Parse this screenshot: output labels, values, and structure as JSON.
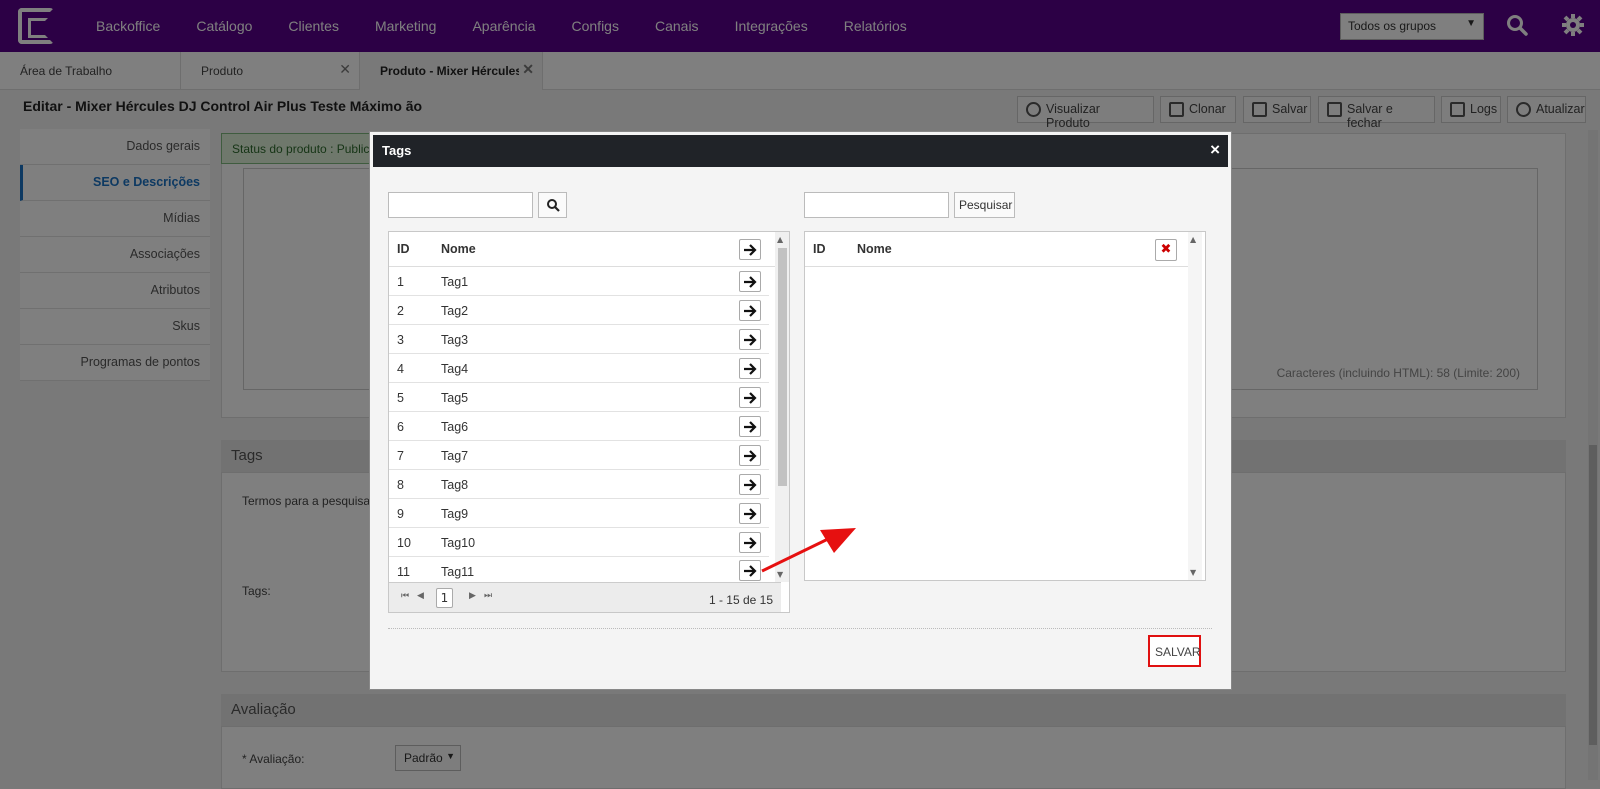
{
  "nav": {
    "items": [
      "Backoffice",
      "Catálogo",
      "Clientes",
      "Marketing",
      "Aparência",
      "Configs",
      "Canais",
      "Integrações",
      "Relatórios"
    ],
    "group_select": "Todos os grupos"
  },
  "tabs": [
    {
      "label": "Área de Trabalho"
    },
    {
      "label": "Produto"
    },
    {
      "label": "Produto - Mixer Hércules"
    }
  ],
  "page": {
    "title": "Editar - Mixer Hércules DJ Control Air Plus Teste Máximo ão",
    "toolbar": {
      "visualizar": "Visualizar Produto",
      "clonar": "Clonar",
      "salvar": "Salvar",
      "salvar_fechar": "Salvar e fechar",
      "logs": "Logs",
      "atualizar": "Atualizar"
    },
    "status": "Status do produto : Publicado",
    "char_count": "Caracteres (incluindo HTML): 58 (Limite: 200)",
    "tags_section": "Tags",
    "tags_terms_label": "Termos para a pesquisa",
    "tags_label": "Tags:",
    "avaliacao_section": "Avaliação",
    "avaliacao_label": "* Avaliação:",
    "avaliacao_value": "Padrão"
  },
  "leftmenu": [
    "Dados gerais",
    "SEO e Descrições",
    "Mídias",
    "Associações",
    "Atributos",
    "Skus",
    "Programas de pontos"
  ],
  "modal": {
    "title": "Tags",
    "close": "×",
    "right_search_button": "Pesquisar",
    "left_grid": {
      "col_id": "ID",
      "col_nome": "Nome",
      "rows": [
        {
          "id": "1",
          "nome": "Tag1"
        },
        {
          "id": "2",
          "nome": "Tag2"
        },
        {
          "id": "3",
          "nome": "Tag3"
        },
        {
          "id": "4",
          "nome": "Tag4"
        },
        {
          "id": "5",
          "nome": "Tag5"
        },
        {
          "id": "6",
          "nome": "Tag6"
        },
        {
          "id": "7",
          "nome": "Tag7"
        },
        {
          "id": "8",
          "nome": "Tag8"
        },
        {
          "id": "9",
          "nome": "Tag9"
        },
        {
          "id": "10",
          "nome": "Tag10"
        },
        {
          "id": "11",
          "nome": "Tag11"
        }
      ],
      "page": "1",
      "range": "1 - 15 de 15"
    },
    "right_grid": {
      "col_id": "ID",
      "col_nome": "Nome",
      "clear": "✖"
    },
    "save_button": "SALVAR"
  }
}
